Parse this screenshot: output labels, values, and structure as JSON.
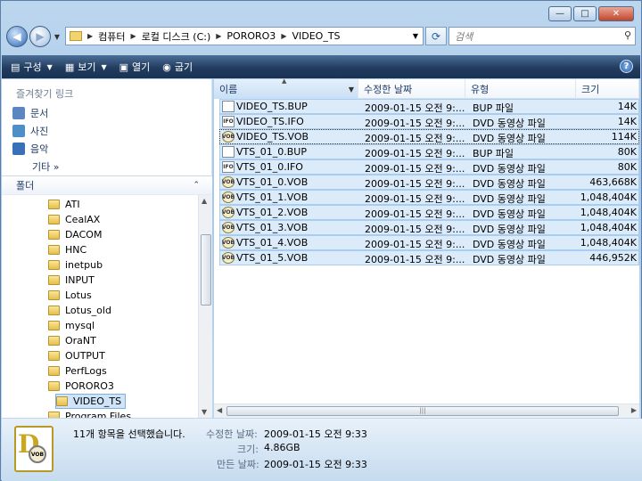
{
  "window": {
    "min_label": "—",
    "max_label": "□",
    "close_label": "✕"
  },
  "nav": {
    "address_crumbs": [
      "컴퓨터",
      "로컬 디스크 (C:)",
      "PORORO3",
      "VIDEO_TS"
    ],
    "search_placeholder": "검색"
  },
  "toolbar": {
    "organize": "구성",
    "views": "보기",
    "open": "열기",
    "burn": "굽기",
    "help": "?"
  },
  "sidebar": {
    "favorites_title": "즐겨찾기 링크",
    "favorites": [
      {
        "label": "문서",
        "color": "#5c86c2"
      },
      {
        "label": "사진",
        "color": "#4f8fc9"
      },
      {
        "label": "음악",
        "color": "#3a70b8"
      }
    ],
    "more_label": "기타 »",
    "folders_header": "폴더",
    "tree": [
      "ATI",
      "CealAX",
      "DACOM",
      "HNC",
      "inetpub",
      "INPUT",
      "Lotus",
      "Lotus_old",
      "mysql",
      "OraNT",
      "OUTPUT",
      "PerfLogs",
      "PORORO3",
      "VIDEO_TS",
      "Program Files"
    ],
    "selected": "VIDEO_TS"
  },
  "columns": {
    "name": "이름",
    "date": "수정한 날짜",
    "type": "유형",
    "size": "크기"
  },
  "files": [
    {
      "name": "VIDEO_TS.BUP",
      "date": "2009-01-15 오전 9:...",
      "type": "BUP 파일",
      "size": "14K",
      "icon": "blank"
    },
    {
      "name": "VIDEO_TS.IFO",
      "date": "2009-01-15 오전 9:...",
      "type": "DVD 동영상 파일",
      "size": "14K",
      "icon": "ifo"
    },
    {
      "name": "VIDEO_TS.VOB",
      "date": "2009-01-15 오전 9:...",
      "type": "DVD 동영상 파일",
      "size": "114K",
      "icon": "vob"
    },
    {
      "name": "VTS_01_0.BUP",
      "date": "2009-01-15 오전 9:...",
      "type": "BUP 파일",
      "size": "80K",
      "icon": "blank"
    },
    {
      "name": "VTS_01_0.IFO",
      "date": "2009-01-15 오전 9:...",
      "type": "DVD 동영상 파일",
      "size": "80K",
      "icon": "ifo"
    },
    {
      "name": "VTS_01_0.VOB",
      "date": "2009-01-15 오전 9:...",
      "type": "DVD 동영상 파일",
      "size": "463,668K",
      "icon": "vob"
    },
    {
      "name": "VTS_01_1.VOB",
      "date": "2009-01-15 오전 9:...",
      "type": "DVD 동영상 파일",
      "size": "1,048,404K",
      "icon": "vob"
    },
    {
      "name": "VTS_01_2.VOB",
      "date": "2009-01-15 오전 9:...",
      "type": "DVD 동영상 파일",
      "size": "1,048,404K",
      "icon": "vob"
    },
    {
      "name": "VTS_01_3.VOB",
      "date": "2009-01-15 오전 9:...",
      "type": "DVD 동영상 파일",
      "size": "1,048,404K",
      "icon": "vob"
    },
    {
      "name": "VTS_01_4.VOB",
      "date": "2009-01-15 오전 9:...",
      "type": "DVD 동영상 파일",
      "size": "1,048,404K",
      "icon": "vob"
    },
    {
      "name": "VTS_01_5.VOB",
      "date": "2009-01-15 오전 9:...",
      "type": "DVD 동영상 파일",
      "size": "446,952K",
      "icon": "vob"
    }
  ],
  "details": {
    "count_text": "11개 항목을 선택했습니다.",
    "modified_label": "수정한 날짜:",
    "modified_value": "2009-01-15 오전 9:33",
    "size_label": "크기:",
    "size_value": "4.86GB",
    "created_label": "만든 날짜:",
    "created_value": "2009-01-15 오전 9:33"
  }
}
